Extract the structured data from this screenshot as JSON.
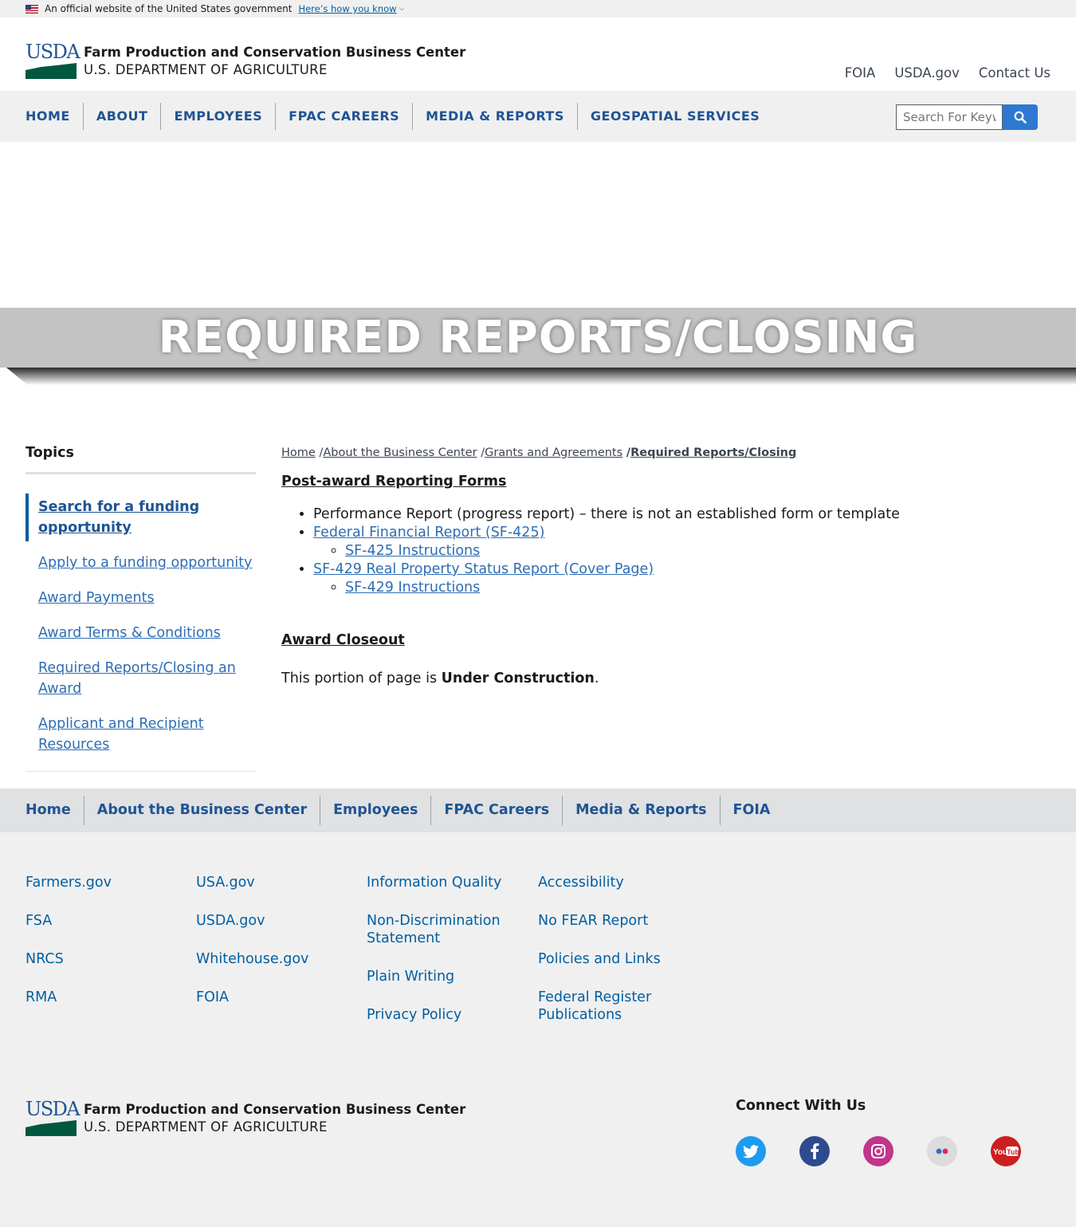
{
  "gov_banner": {
    "text": "An official website of the United States government",
    "link": "Here’s how you know"
  },
  "header": {
    "logo_mark": "USDA",
    "title": "Farm Production and Conservation Business Center",
    "subtitle": "U.S. DEPARTMENT OF AGRICULTURE",
    "utility_links": [
      "FOIA",
      "USDA.gov",
      "Contact Us"
    ]
  },
  "nav": {
    "items": [
      "HOME",
      "ABOUT",
      "EMPLOYEES",
      "FPAC CAREERS",
      "MEDIA & REPORTS",
      "GEOSPATIAL SERVICES"
    ]
  },
  "search": {
    "placeholder": "Search For Keywords",
    "icon": "search-icon"
  },
  "hero": {
    "title": "REQUIRED REPORTS/CLOSING"
  },
  "sidebar": {
    "heading": "Topics",
    "items": [
      {
        "label": "Search for a funding opportunity",
        "current": true
      },
      {
        "label": "Apply to a funding opportunity",
        "current": false
      },
      {
        "label": "Award Payments",
        "current": false
      },
      {
        "label": "Award Terms & Conditions",
        "current": false
      },
      {
        "label": "Required Reports/Closing an Award",
        "current": false
      },
      {
        "label": "Applicant and Recipient Resources",
        "current": false
      }
    ]
  },
  "breadcrumb": {
    "items": [
      "Home",
      "About the Business Center",
      "Grants and Agreements"
    ],
    "current": "Required Reports/Closing"
  },
  "content": {
    "section1_title": "Post-award Reporting Forms",
    "item1": "Performance Report (progress report) – there is not an established form or template",
    "item2": "Federal Financial Report (SF-425)",
    "item2_sub": "SF-425 Instructions",
    "item3": "SF-429 Real Property Status Report (Cover Page)",
    "item3_sub": "SF-429 Instructions",
    "section2_title": "Award Closeout",
    "para_prefix": "This portion of page is ",
    "para_bold": "Under Construction",
    "para_suffix": "."
  },
  "footer_nav": {
    "items": [
      "Home",
      "About the Business Center",
      "Employees",
      "FPAC Careers",
      "Media & Reports",
      "FOIA"
    ]
  },
  "footer_links": {
    "col1": [
      "Farmers.gov",
      "FSA",
      "NRCS",
      "RMA"
    ],
    "col2": [
      "USA.gov",
      "USDA.gov",
      "Whitehouse.gov",
      "FOIA"
    ],
    "col3": [
      "Information Quality",
      "Non-Discrimination Statement",
      "Plain Writing",
      "Privacy Policy"
    ],
    "col4": [
      "Accessibility",
      "No FEAR Report",
      "Policies and Links",
      "Federal Register Publications"
    ]
  },
  "connect": {
    "heading": "Connect With Us",
    "icons": [
      "twitter-icon",
      "facebook-icon",
      "instagram-icon",
      "flickr-icon",
      "youtube-icon"
    ]
  },
  "colors": {
    "primary": "#205493",
    "link": "#005ea2",
    "usda_green": "#00573f",
    "search_button": "#2e78d2",
    "hero_band": "#c3c3c3"
  }
}
